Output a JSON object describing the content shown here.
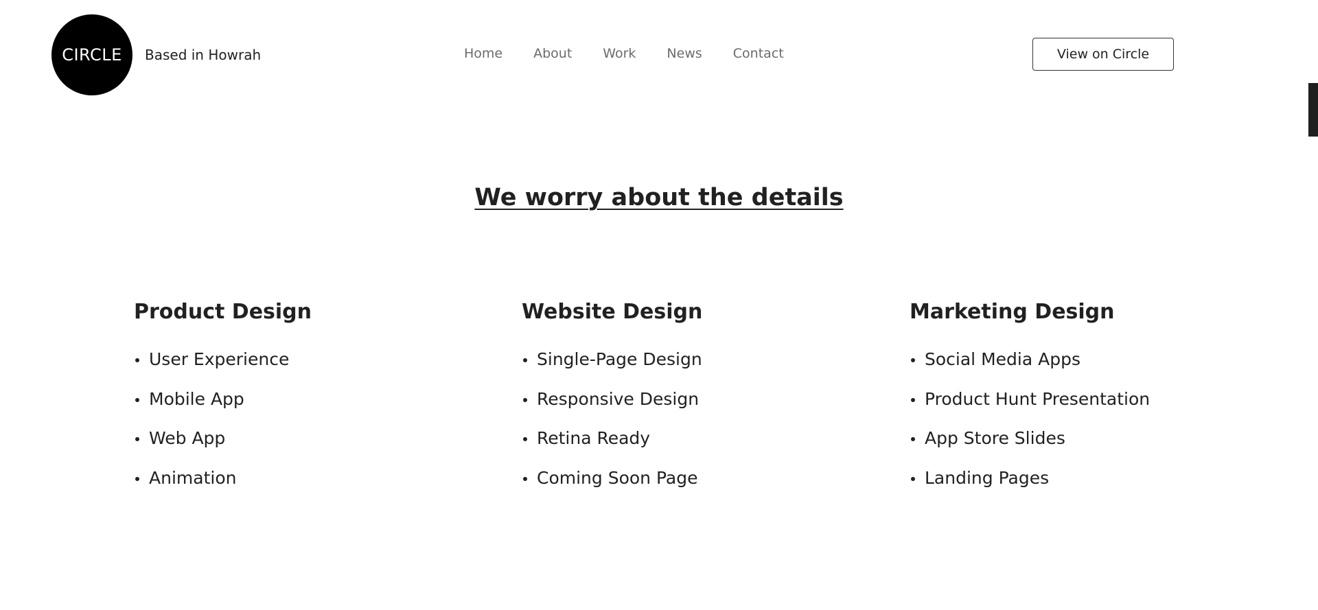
{
  "header": {
    "logo_text": "CIRCLE",
    "tagline": "Based in Howrah",
    "nav": [
      "Home",
      "About",
      "Work",
      "News",
      "Contact"
    ],
    "cta_label": "View on Circle"
  },
  "section": {
    "headline": "We worry about the details",
    "columns": [
      {
        "title": "Product Design",
        "items": [
          "User Experience",
          "Mobile App",
          "Web App",
          "Animation"
        ]
      },
      {
        "title": "Website Design",
        "items": [
          "Single-Page Design",
          "Responsive Design",
          "Retina Ready",
          "Coming Soon Page"
        ]
      },
      {
        "title": "Marketing Design",
        "items": [
          "Social Media Apps",
          "Product Hunt Presentation",
          "App Store Slides",
          "Landing Pages"
        ]
      }
    ]
  },
  "colors": {
    "text": "#212121",
    "nav_text": "#6b6b6b",
    "logo_bg": "#000000"
  }
}
